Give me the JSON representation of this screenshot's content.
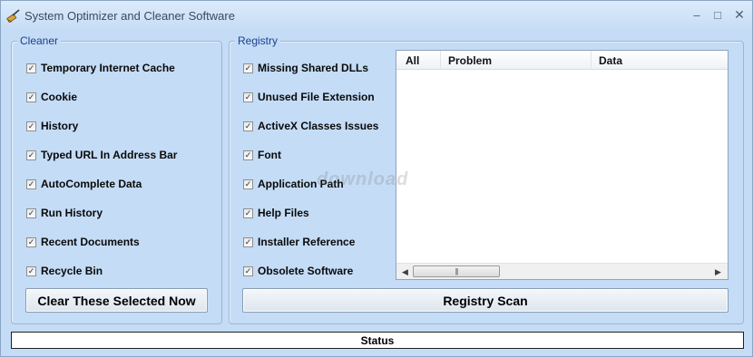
{
  "window": {
    "title": "System Optimizer and Cleaner Software",
    "minimize_glyph": "–",
    "maximize_glyph": "□",
    "close_glyph": "✕"
  },
  "cleaner": {
    "label": "Cleaner",
    "items": [
      {
        "label": "Temporary Internet Cache",
        "checked": true
      },
      {
        "label": "Cookie",
        "checked": true
      },
      {
        "label": "History",
        "checked": true
      },
      {
        "label": "Typed URL In Address Bar",
        "checked": true
      },
      {
        "label": "AutoComplete Data",
        "checked": true
      },
      {
        "label": "Run History",
        "checked": true
      },
      {
        "label": "Recent Documents",
        "checked": true
      },
      {
        "label": "Recycle Bin",
        "checked": true
      }
    ],
    "button_label": "Clear These Selected Now"
  },
  "registry": {
    "label": "Registry",
    "items": [
      {
        "label": "Missing Shared DLLs",
        "checked": true
      },
      {
        "label": "Unused File Extension",
        "checked": true
      },
      {
        "label": "ActiveX Classes Issues",
        "checked": true
      },
      {
        "label": "Font",
        "checked": true
      },
      {
        "label": "Application Path",
        "checked": true
      },
      {
        "label": "Help Files",
        "checked": true
      },
      {
        "label": "Installer Reference",
        "checked": true
      },
      {
        "label": "Obsolete Software",
        "checked": true
      }
    ],
    "columns": [
      "All",
      "Problem",
      "Data"
    ],
    "button_label": "Registry Scan"
  },
  "status": {
    "text": "Status"
  },
  "watermark": {
    "text": "download"
  },
  "check_glyph": "✓",
  "icons": {
    "app": "broom-icon",
    "minimize": "minimize-icon",
    "maximize": "maximize-icon",
    "close": "close-icon"
  },
  "colors": {
    "window_bg": "#c4dcf6",
    "group_label": "#1d3f8f",
    "status_border": "#202020"
  }
}
